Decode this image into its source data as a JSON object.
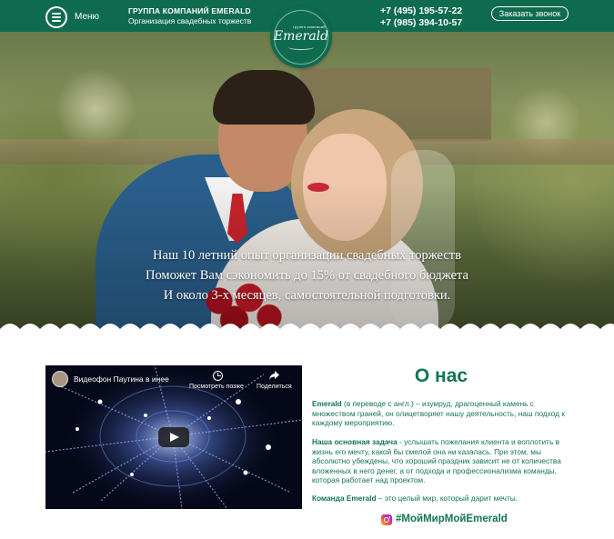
{
  "header": {
    "menu_label": "Меню",
    "company": "ГРУППА КОМПАНИЙ EMERALD",
    "tagline": "Организация свадебных торжеств",
    "logo_small": "группа компаний",
    "logo_text": "Emerald",
    "phone1": "+7 (495) 195-57-22",
    "phone2": "+7 (985) 394-10-57",
    "call_button": "Заказать звонок"
  },
  "hero": {
    "line1": "Наш 10 летний опыт организации свадебных торжеств",
    "line2": "Поможет Вам сэкономить до 15% от свадебного бюджета",
    "line3": "И около 3-х месяцев, самостоятельной подготовки."
  },
  "video": {
    "title": "Видеофон Паутина в инее",
    "watch_later": "Посмотреть позже",
    "share": "Поделиться"
  },
  "about": {
    "title": "О нас",
    "p1_bold": "Emerald",
    "p1_text": " (в переводе с англ.) – изумруд, драгоценный камень с множеством граней, он олицетворяет нашу деятельность, наш подход к каждому мероприятию.",
    "p2_bold": "Наша основная задача",
    "p2_text": " - услышать пожелания клиента и воплотить в жизнь его мечту, какой бы смелой она ни казалась. При этом, мы абсолютно убеждены, что хороший праздник зависит не от количества вложенных в него денег, а от подхода и профессионализма команды, которая работает над проектом.",
    "p3_bold": "Команда Emerald",
    "p3_text": " – это целый мир, который дарит мечты.",
    "hashtag": "#МойМирМойEmerald"
  },
  "colors": {
    "brand": "#0f6b4e",
    "text_green": "#137555"
  }
}
